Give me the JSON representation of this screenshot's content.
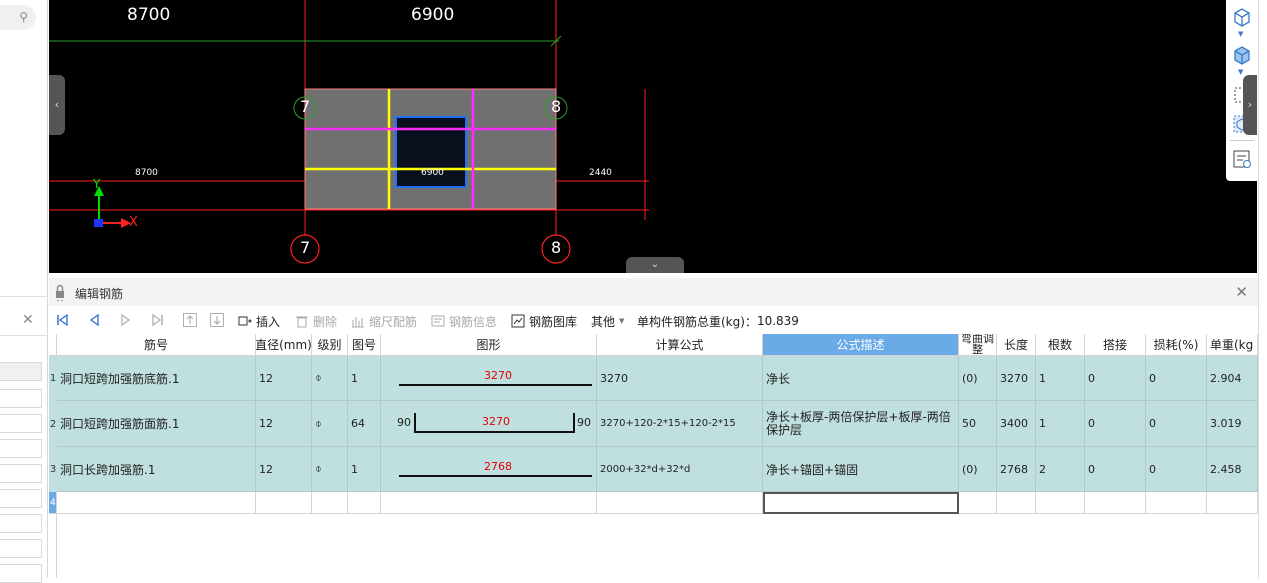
{
  "viewport": {
    "top_dims": [
      "8700",
      "6900"
    ],
    "mid_dims": [
      "8700",
      "6900",
      "2440"
    ],
    "axis_tags_top": [
      "7",
      "8"
    ],
    "axis_tags_bottom": [
      "7",
      "8"
    ],
    "axis_labels": {
      "x": "X",
      "y": "Y"
    }
  },
  "panel": {
    "title": "编辑钢筋"
  },
  "toolbar": {
    "insert": "插入",
    "delete": "删除",
    "scale_rebar": "缩尺配筋",
    "rebar_info": "钢筋信息",
    "rebar_library": "钢筋图库",
    "other": "其他",
    "total_weight_label": "单构件钢筋总重(kg)：",
    "total_weight_value": "10.839"
  },
  "table": {
    "headers": {
      "name": "筋号",
      "diameter": "直径(mm)",
      "grade": "级别",
      "shape_no": "图号",
      "shape": "图形",
      "formula": "计算公式",
      "formula_desc": "公式描述",
      "bend_adj": "弯曲调整",
      "length": "长度",
      "count": "根数",
      "lap": "搭接",
      "loss": "损耗(%)",
      "unit_weight": "单重(kg"
    },
    "rows": [
      {
        "no": "1",
        "name": "洞口短跨加强筋底筋.1",
        "diameter": "12",
        "grade": "⌽",
        "shape_no": "1",
        "shape_value": "3270",
        "shape_left": "",
        "shape_right": "",
        "formula": "3270",
        "formula_desc": "净长",
        "bend_adj": "(0)",
        "length": "3270",
        "count": "1",
        "lap": "0",
        "loss": "0",
        "unit_weight": "2.904"
      },
      {
        "no": "2",
        "name": "洞口短跨加强筋面筋.1",
        "diameter": "12",
        "grade": "⌽",
        "shape_no": "64",
        "shape_value": "3270",
        "shape_left": "90",
        "shape_right": "90",
        "formula": "3270+120-2*15+120-2*15",
        "formula_desc": "净长+板厚-两倍保护层+板厚-两倍保护层",
        "bend_adj": "50",
        "length": "3400",
        "count": "1",
        "lap": "0",
        "loss": "0",
        "unit_weight": "3.019"
      },
      {
        "no": "3",
        "name": "洞口长跨加强筋.1",
        "diameter": "12",
        "grade": "⌽",
        "shape_no": "1",
        "shape_value": "2768",
        "shape_left": "",
        "shape_right": "",
        "formula": "2000+32*d+32*d",
        "formula_desc": "净长+锚固+锚固",
        "bend_adj": "(0)",
        "length": "2768",
        "count": "2",
        "lap": "0",
        "loss": "0",
        "unit_weight": "2.458"
      }
    ],
    "empty_row_no": "4"
  }
}
